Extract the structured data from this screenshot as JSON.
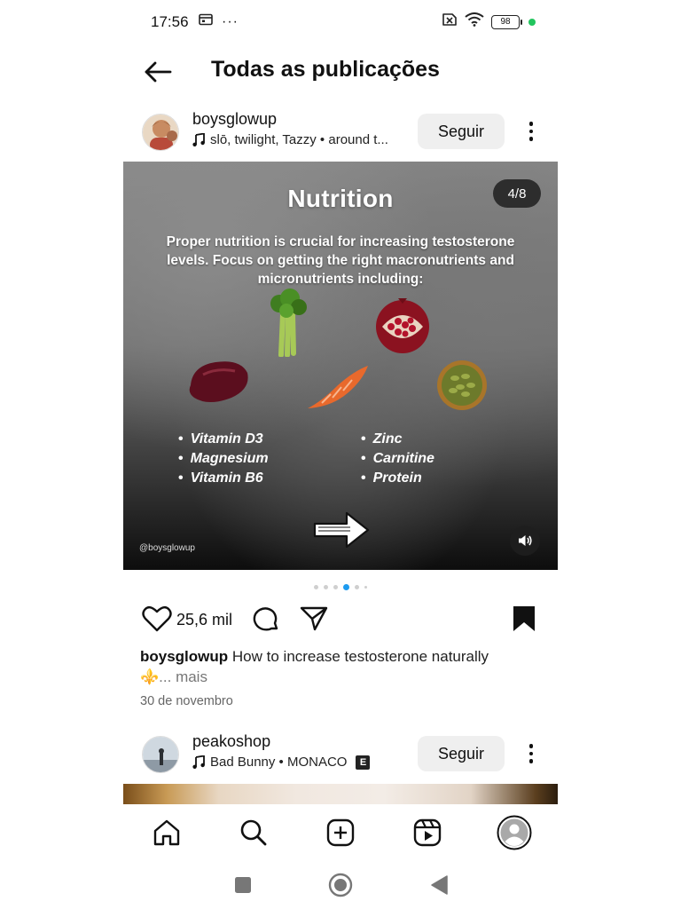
{
  "status_bar": {
    "time": "17:56",
    "battery": "98",
    "dots": "···"
  },
  "header": {
    "title": "Todas as publicações"
  },
  "post1": {
    "username": "boysglowup",
    "music": "slō, twilight, Tazzy • around t...",
    "follow_label": "Seguir",
    "slide": {
      "title": "Nutrition",
      "counter": "4/8",
      "body": "Proper nutrition is crucial for increasing testosterone levels. Focus on getting the right macronutrients and micronutrients including:",
      "list_left": [
        "Vitamin D3",
        "Magnesium",
        "Vitamin B6"
      ],
      "list_right": [
        "Zinc",
        "Carnitine",
        "Protein"
      ],
      "watermark": "@boysglowup"
    },
    "carousel": {
      "count": 6,
      "active_index": 3
    },
    "likes": "25,6 mil",
    "caption_user": "boysglowup",
    "caption_text": "How to increase testosterone naturally",
    "caption_emoji": "⚜️",
    "caption_more": "... mais",
    "date": "30 de novembro"
  },
  "post2": {
    "username": "peakoshop",
    "music": "Bad Bunny • MONACO",
    "explicit": "E",
    "follow_label": "Seguir"
  },
  "colors": {
    "accent": "#1d9bf0",
    "follow_bg": "#efefef",
    "status_green": "#22c55e"
  },
  "icons": {
    "nav": [
      "home-icon",
      "search-icon",
      "create-icon",
      "reels-icon",
      "profile-icon"
    ],
    "system": [
      "recents-icon",
      "home-circle-icon",
      "back-triangle-icon"
    ]
  }
}
